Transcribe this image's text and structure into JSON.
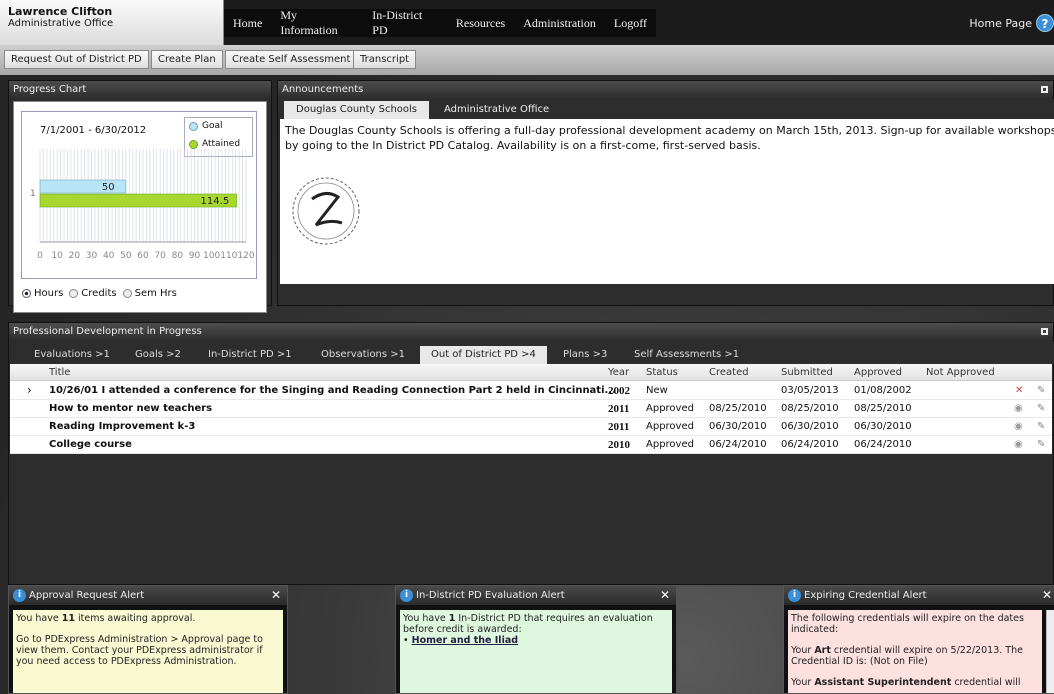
{
  "user": {
    "name": "Lawrence Clifton",
    "office": "Administrative Office"
  },
  "nav": [
    "Home",
    "My Information",
    "In-District PD",
    "Resources",
    "Administration",
    "Logoff"
  ],
  "home_page": "Home Page",
  "actions": [
    "Request Out of District PD",
    "Create Plan",
    "Create Self Assessment",
    "Transcript"
  ],
  "progress": {
    "title": "Progress Chart",
    "date_range": "7/1/2001 - 6/30/2012",
    "legend": [
      "Goal",
      "Attained"
    ],
    "chart_data": {
      "type": "bar",
      "categories": [
        "1"
      ],
      "series": [
        {
          "name": "Goal",
          "values": [
            50
          ]
        },
        {
          "name": "Attained",
          "values": [
            114.5
          ]
        }
      ],
      "xlim": [
        0,
        120
      ],
      "xticks": [
        "0",
        "10",
        "20",
        "30",
        "40",
        "50",
        "60",
        "70",
        "80",
        "90",
        "100",
        "110",
        "120"
      ]
    },
    "units": [
      "Hours",
      "Credits",
      "Sem Hrs"
    ]
  },
  "announcements": {
    "title": "Announcements",
    "tabs": [
      "Douglas County Schools",
      "Administrative Office"
    ],
    "text": "The Douglas County Schools is offering a full-day professional development academy on March 15th, 2013.  Sign-up for available workshops by going to the In District PD Catalog. Availability is on a first-come, first-served basis."
  },
  "pd": {
    "title": "Professional Development in Progress",
    "tabs": [
      "Evaluations >1",
      "Goals >2",
      "In-District PD >1",
      "Observations >1",
      "Out of District PD >4",
      "Plans >3",
      "Self Assessments >1"
    ],
    "columns": [
      "Title",
      "Year",
      "Status",
      "Created",
      "Submitted",
      "Approved",
      "Not Approved"
    ],
    "rows": [
      {
        "title": "10/26/01 I attended a conference for the Singing and Reading Connection Part 2 held in Cincinnati...",
        "year": "2002",
        "status": "New",
        "created": "",
        "submitted": "03/05/2013",
        "approved": "01/08/2002"
      },
      {
        "title": "How to mentor new teachers",
        "year": "2011",
        "status": "Approved",
        "created": "08/25/2010",
        "submitted": "08/25/2010",
        "approved": "08/25/2010"
      },
      {
        "title": "Reading Improvement k-3",
        "year": "2011",
        "status": "Approved",
        "created": "06/30/2010",
        "submitted": "06/30/2010",
        "approved": "06/30/2010"
      },
      {
        "title": "College course",
        "year": "2010",
        "status": "Approved",
        "created": "06/24/2010",
        "submitted": "06/24/2010",
        "approved": "06/24/2010"
      }
    ]
  },
  "alerts": {
    "approval": {
      "title": "Approval Request Alert",
      "l1a": "You have ",
      "l1b": "11",
      "l1c": " items awaiting approval.",
      "l2": "Go to PDExpress Administration > Approval page to view them. Contact your PDExpress administrator if you need access to PDExpress Administration."
    },
    "eval": {
      "title": "In-District PD Evaluation Alert",
      "l1a": "You have ",
      "l1b": "1",
      "l1c": " In-District PD that requires an evaluation before credit is awarded:",
      "link": "Homer and the Iliad"
    },
    "cred": {
      "title": "Expiring Credential Alert",
      "l1": "The following credentials will expire on the dates indicated:",
      "l2a": "Your ",
      "l2b": "Art",
      "l2c": " credential will expire on 5/22/2013. The Credential ID is: (Not on File)",
      "l3a": "Your ",
      "l3b": "Assistant Superintendent",
      "l3c": " credential will"
    }
  },
  "colors": {
    "goal": "#b8e4f8",
    "attained": "#a8d830",
    "alert_yellow": "#fafad2",
    "alert_green": "#dff7df",
    "alert_pink": "#fde0e0"
  }
}
